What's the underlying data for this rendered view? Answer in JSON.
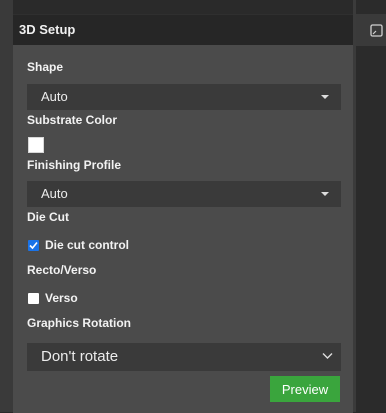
{
  "panel": {
    "title": "3D Setup"
  },
  "fields": {
    "shape": {
      "label": "Shape",
      "value": "Auto"
    },
    "substrate_color": {
      "label": "Substrate Color",
      "swatch": "#ffffff"
    },
    "finishing_profile": {
      "label": "Finishing Profile",
      "value": "Auto"
    },
    "die_cut": {
      "label": "Die Cut",
      "checkbox_label": "Die cut control",
      "checked": true
    },
    "recto_verso": {
      "label": "Recto/Verso",
      "checkbox_label": "Verso",
      "checked": false
    },
    "graphics_rotation": {
      "label": "Graphics Rotation",
      "value": "Don't rotate"
    }
  },
  "actions": {
    "preview_label": "Preview"
  },
  "colors": {
    "accent_green": "#3aa53d",
    "checkbox_blue": "#1a73e8",
    "panel_bg": "#4b4b4b",
    "header_bg": "#262626"
  },
  "icons": [
    "document-icon",
    "dropdown-arrow-icon",
    "chevron-down-icon",
    "checkmark-icon"
  ]
}
